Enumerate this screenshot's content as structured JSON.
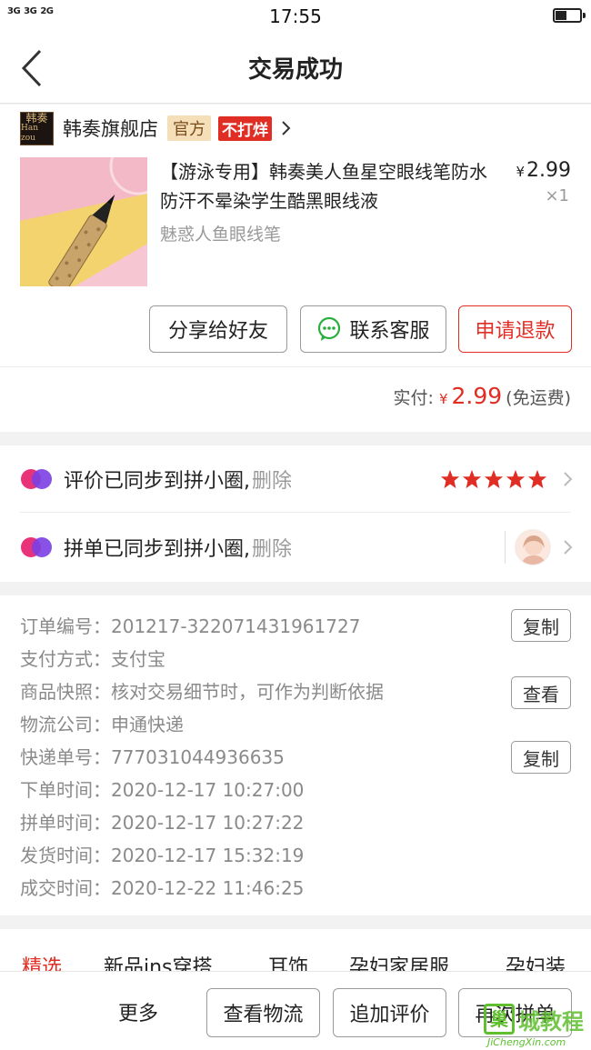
{
  "status_bar": {
    "network": [
      "3G",
      "3G",
      "2G"
    ],
    "time": "17:55"
  },
  "header": {
    "title": "交易成功"
  },
  "store": {
    "logo_text_cn": "韩奏",
    "logo_text_en": "Han zou",
    "name": "韩奏旗舰店",
    "tag_official": "官方",
    "tag_no_discount": "不打烊"
  },
  "product": {
    "title": "【游泳专用】韩奏美人鱼星空眼线笔防水防汗不晕染学生酷黑眼线液",
    "variant": "魅惑人鱼眼线笔",
    "price_symbol": "¥",
    "price": "2.99",
    "quantity": "×1"
  },
  "actions": {
    "share": "分享给好友",
    "contact": "联系客服",
    "refund": "申请退款"
  },
  "payment": {
    "label": "实付:",
    "symbol": "¥",
    "amount": "2.99",
    "note": "(免运费)"
  },
  "sync": {
    "review_text": "评价已同步到拼小圈,",
    "review_delete": "删除",
    "review_rating": 5,
    "group_text": "拼单已同步到拼小圈,",
    "group_delete": "删除"
  },
  "order_info": {
    "order_no": "订单编号：201217-322071431961727",
    "pay_method": "支付方式：支付宝",
    "snapshot": "商品快照：核对交易细节时，可作为判断依据",
    "logistics": "物流公司：申通快递",
    "tracking_no": "快递单号：777031044936635",
    "order_time": "下单时间：2020-12-17 10:27:00",
    "group_time": "拼单时间：2020-12-17 10:27:22",
    "ship_time": "发货时间：2020-12-17 15:32:19",
    "deal_time": "成交时间：2020-12-22 11:46:25",
    "copy_label": "复制",
    "view_label": "查看"
  },
  "tabs": [
    "精选",
    "新品ins穿搭",
    "耳饰",
    "孕妇家居服",
    "孕妇装"
  ],
  "bottom_bar": {
    "more": "更多",
    "logistics": "查看物流",
    "add_review": "追加评价",
    "rebuy": "再次拼单"
  },
  "watermark": {
    "box": "巢",
    "text": "城教程",
    "url": "JiChengXin.com"
  },
  "colors": {
    "accent_red": "#e02e24",
    "official_tag_bg": "#f5dfb8",
    "watermark_green": "#5fbf2f"
  }
}
